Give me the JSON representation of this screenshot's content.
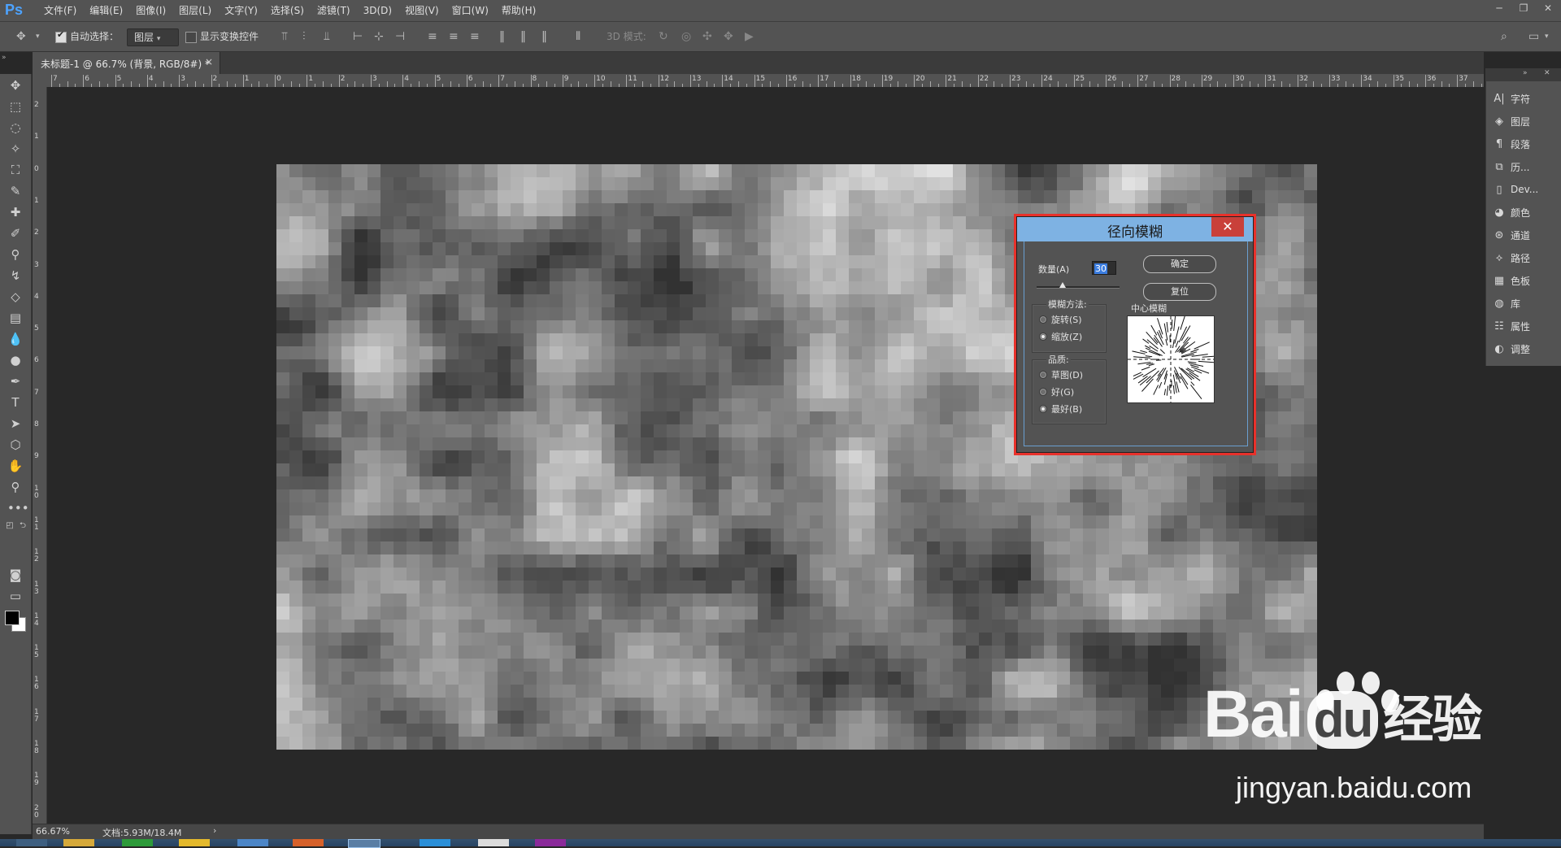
{
  "app": {
    "logo": "Ps",
    "menu": [
      "文件(F)",
      "编辑(E)",
      "图像(I)",
      "图层(L)",
      "文字(Y)",
      "选择(S)",
      "滤镜(T)",
      "3D(D)",
      "视图(V)",
      "窗口(W)",
      "帮助(H)"
    ]
  },
  "options_bar": {
    "auto_select_label": "自动选择：",
    "auto_select_checked": true,
    "auto_select_value": "图层",
    "show_transform_label": "显示变换控件",
    "show_transform_checked": false,
    "mode_3d_label": "3D 模式:"
  },
  "document_tab": {
    "title": "未标题-1 @ 66.7% (背景, RGB/8#) *",
    "close": "×"
  },
  "ruler": {
    "top_labels": [
      "7",
      "6",
      "5",
      "4",
      "3",
      "2",
      "1",
      "0",
      "1",
      "2",
      "3",
      "4",
      "5",
      "6",
      "7",
      "8",
      "9",
      "10",
      "11",
      "12",
      "13",
      "14",
      "15",
      "16",
      "17",
      "18",
      "19",
      "20",
      "21",
      "22",
      "23",
      "24",
      "25",
      "26",
      "27",
      "28",
      "29",
      "30",
      "31",
      "32",
      "33",
      "34",
      "35",
      "36",
      "37"
    ],
    "left_labels": [
      "2",
      "1",
      "0",
      "1",
      "2",
      "3",
      "4",
      "5",
      "6",
      "7",
      "8",
      "9",
      "1 0",
      "1 1",
      "1 2",
      "1 3",
      "1 4",
      "1 5",
      "1 6",
      "1 7",
      "1 8",
      "1 9",
      "2 0"
    ]
  },
  "panels": [
    {
      "icon": "character-icon",
      "label": "字符"
    },
    {
      "icon": "layers-icon",
      "label": "图层"
    },
    {
      "icon": "paragraph-icon",
      "label": "段落"
    },
    {
      "icon": "history-icon",
      "label": "历..."
    },
    {
      "icon": "device-preview-icon",
      "label": "Dev..."
    },
    {
      "icon": "color-icon",
      "label": "颜色"
    },
    {
      "icon": "channels-icon",
      "label": "通道"
    },
    {
      "icon": "paths-icon",
      "label": "路径"
    },
    {
      "icon": "swatches-icon",
      "label": "色板"
    },
    {
      "icon": "libraries-icon",
      "label": "库"
    },
    {
      "icon": "properties-icon",
      "label": "属性"
    },
    {
      "icon": "adjustments-icon",
      "label": "调整"
    }
  ],
  "status_bar": {
    "zoom": "66.67%",
    "doc_info": "文档:5.93M/18.4M",
    "arrow": "›"
  },
  "dialog": {
    "title": "径向模糊",
    "close": "✕",
    "amount_label": "数量(A)",
    "amount_value": "30",
    "ok_label": "确定",
    "reset_label": "复位",
    "blur_method_label": "模糊方法:",
    "blur_methods": [
      {
        "label": "旋转(S)",
        "selected": false
      },
      {
        "label": "缩放(Z)",
        "selected": true
      }
    ],
    "quality_label": "品质:",
    "qualities": [
      {
        "label": "草图(D)",
        "selected": false
      },
      {
        "label": "好(G)",
        "selected": false
      },
      {
        "label": "最好(B)",
        "selected": true
      }
    ],
    "center_label": "中心模糊"
  },
  "watermark": {
    "logo_text": "Bai",
    "logo_du": "du",
    "logo_cn": "经验",
    "url": "jingyan.baidu.com"
  },
  "colors": {
    "accent": "#4da3ff",
    "dialog_title_bg": "#7eb2e3",
    "highlight": "#e8312b",
    "close_bg": "#c9403a"
  }
}
